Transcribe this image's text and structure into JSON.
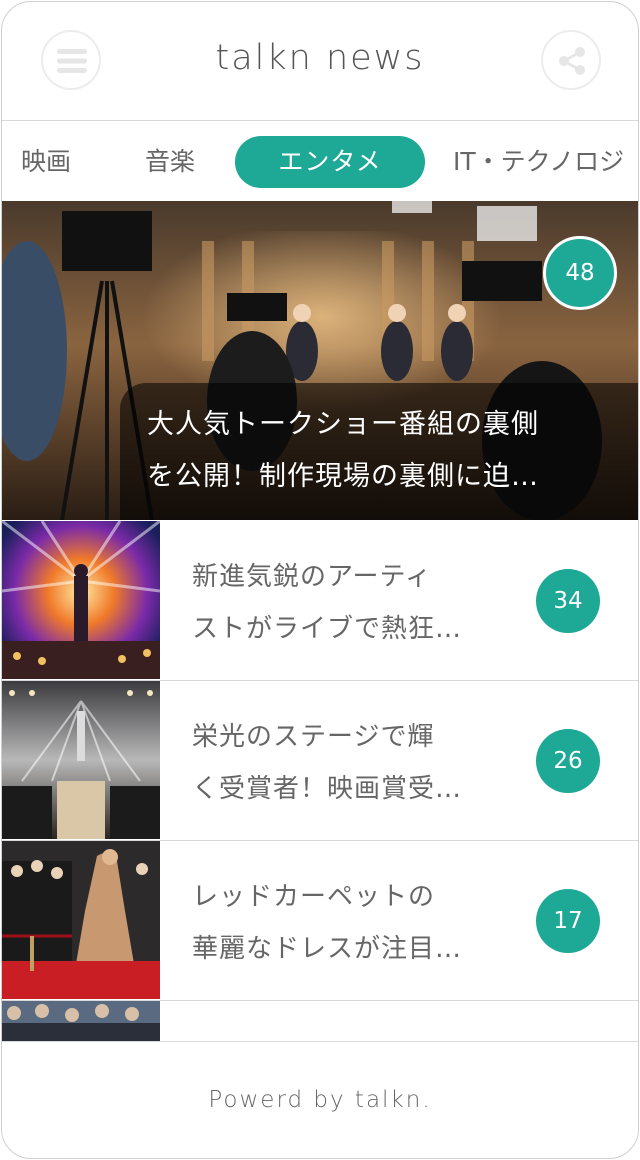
{
  "header": {
    "title": "talkn news",
    "menu_icon": "hamburger-menu-icon",
    "share_icon": "share-icon"
  },
  "tabs": [
    {
      "label": "映画",
      "active": false
    },
    {
      "label": "音楽",
      "active": false
    },
    {
      "label": "エンタメ",
      "active": true
    },
    {
      "label": "IT・テクノロジ",
      "active": false
    }
  ],
  "hero": {
    "count": "48",
    "title_line1": "大人気トークショー番組の裏側",
    "title_line2": "を公開！制作現場の裏側に迫…"
  },
  "articles": [
    {
      "title_line1": "新進気鋭のアーティ",
      "title_line2": "ストがライブで熱狂…",
      "count": "34"
    },
    {
      "title_line1": "栄光のステージで輝",
      "title_line2": "く受賞者！映画賞受…",
      "count": "26"
    },
    {
      "title_line1": "レッドカーペットの",
      "title_line2": "華麗なドレスが注目…",
      "count": "17"
    }
  ],
  "footer": {
    "text": "Powerd by talkn."
  },
  "colors": {
    "accent": "#1ea896",
    "border": "#d8d8d8",
    "text": "#666666"
  }
}
